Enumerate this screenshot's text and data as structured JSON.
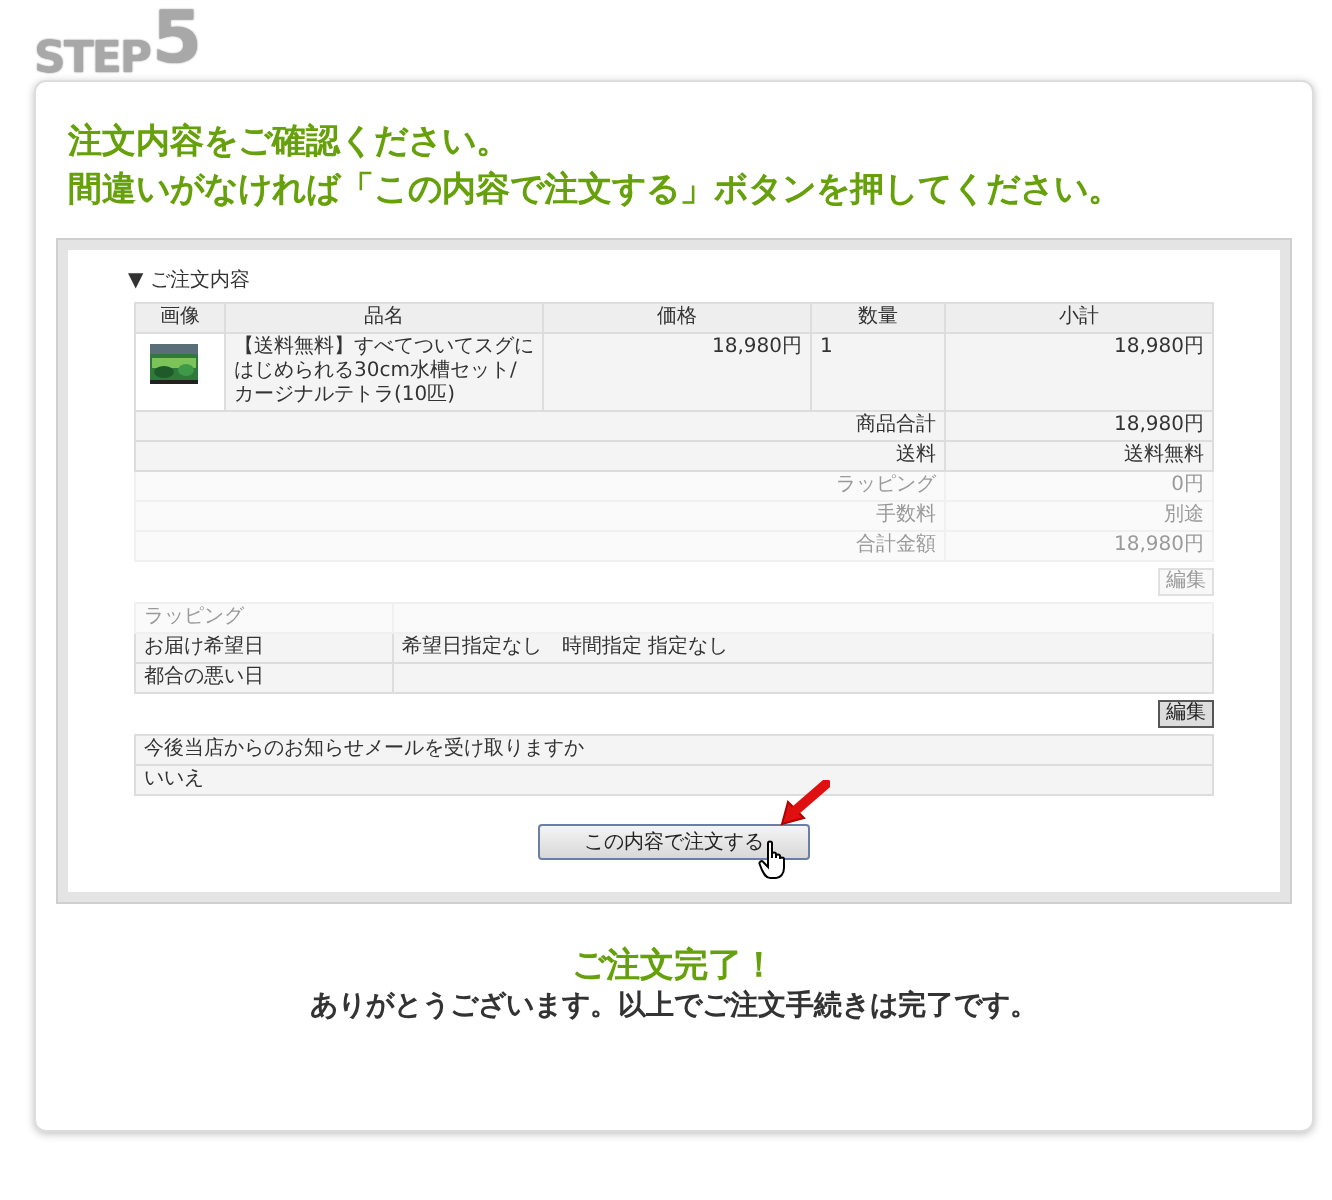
{
  "step": {
    "label": "STEP",
    "number": "5"
  },
  "instructions": [
    "注文内容をご確認ください。",
    "間違いがなければ「この内容で注文する」ボタンを押してください。"
  ],
  "screenshot": {
    "section_title": "▼ ご注文内容",
    "columns": [
      "画像",
      "品名",
      "価格",
      "数量",
      "小計"
    ],
    "items": [
      {
        "name": "【送料無料】すべてついてスグにはじめられる30cm水槽セット/カージナルテトラ(10匹)",
        "price": "18,980円",
        "quantity": "1",
        "subtotal": "18,980円"
      }
    ],
    "summary": [
      {
        "label": "商品合計",
        "value": "18,980円",
        "faded": false
      },
      {
        "label": "送料",
        "value": "送料無料",
        "faded": false
      },
      {
        "label": "ラッピング",
        "value": "0円",
        "faded": true
      },
      {
        "label": "手数料",
        "value": "別途",
        "faded": true
      },
      {
        "label": "合計金額",
        "value": "18,980円",
        "faded": true
      }
    ],
    "delivery_edit": {
      "label": "編集",
      "faded": true
    },
    "delivery": [
      {
        "label": "ラッピング",
        "faded": true
      },
      {
        "label": "お届け希望日",
        "value": "希望日指定なし　時間指定 指定なし",
        "faded": false
      },
      {
        "label": "都合の悪い日",
        "faded": false
      }
    ],
    "mail_edit": {
      "label": "編集",
      "faded": false
    },
    "mail": {
      "question": "今後当店からのお知らせメールを受け取りますか",
      "answer": "いいえ"
    },
    "submit": "この内容で注文する"
  },
  "complete": {
    "title": "ご注文完了！",
    "message": "ありがとうございます。以上でご注文手続きは完了です。"
  }
}
